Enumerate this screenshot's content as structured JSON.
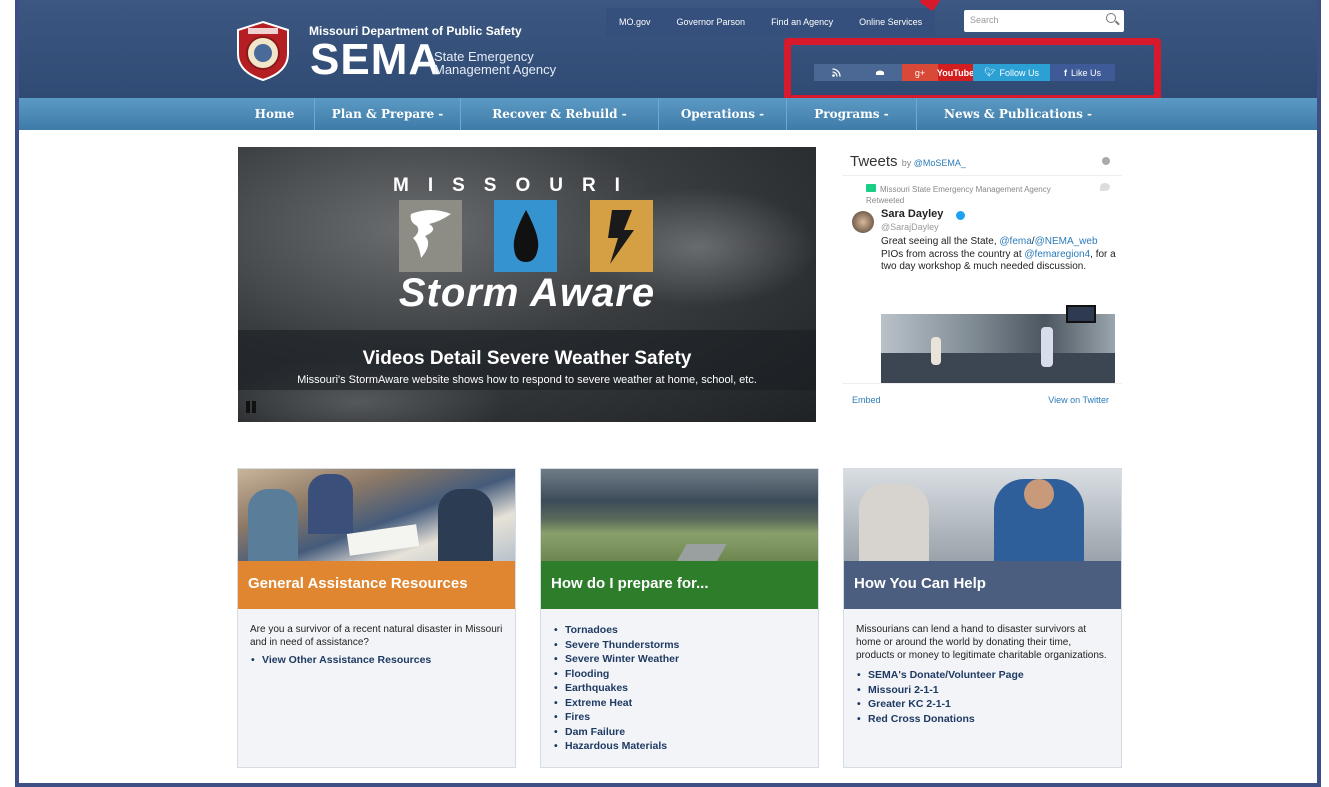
{
  "header": {
    "dept": "Missouri Department of Public Safety",
    "sema": "SEMA",
    "sema_sub_1": "State Emergency",
    "sema_sub_2": "Management Agency",
    "top_links": [
      "MO.gov",
      "Governor Parson",
      "Find an Agency",
      "Online Services"
    ],
    "search_placeholder": "Search",
    "social": {
      "gplus": "g+",
      "youtube": "YouTube",
      "twitter": "Follow Us",
      "facebook": "Like Us"
    },
    "colors": {
      "highlight": "#d8192c",
      "header_bg": "#3c5882"
    }
  },
  "nav": [
    "Home",
    "Plan & Prepare -",
    "Recover & Rebuild -",
    "Operations -",
    "Programs -",
    "News & Publications -"
  ],
  "hero": {
    "missouri": "MISSOURI",
    "brand": "Storm Aware",
    "title": "Videos Detail Severe Weather Safety",
    "subtitle": "Missouri's StormAware website shows how to respond to severe weather at home, school, etc."
  },
  "tweets": {
    "heading": "Tweets",
    "by": "by",
    "by_handle": "@MoSEMA_",
    "retweet_note": "Missouri State Emergency Management Agency Retweeted",
    "name": "Sara Dayley",
    "handle": "@SarajDayley",
    "text_1": "Great seeing all the State, ",
    "link_1": "@fema",
    "text_2": "/",
    "link_2": "@NEMA_web",
    "text_3": "  PIOs from across the country at ",
    "link_3": "@femaregion4",
    "text_4": ", for a two day workshop & much needed discussion.",
    "embed": "Embed",
    "view_on_twitter": "View on Twitter"
  },
  "cards": [
    {
      "title": "General Assistance Resources",
      "body": "Are you a survivor of a recent natural disaster in Missouri and in need of assistance?",
      "links": [
        "View Other Assistance Resources"
      ]
    },
    {
      "title": "How do I prepare for...",
      "body": "",
      "links": [
        "Tornadoes",
        "Severe Thunderstorms",
        "Severe Winter Weather",
        "Flooding",
        "Earthquakes",
        "Extreme Heat",
        "Fires",
        "Dam Failure",
        "Hazardous Materials"
      ]
    },
    {
      "title": "How You Can Help",
      "body": "Missourians can lend a hand to disaster survivors at home or around the world by donating their time, products or money to legitimate charitable organizations.",
      "links": [
        "SEMA's Donate/Volunteer Page",
        "Missouri 2-1-1",
        "Greater KC 2-1-1",
        "Red Cross Donations"
      ]
    }
  ]
}
